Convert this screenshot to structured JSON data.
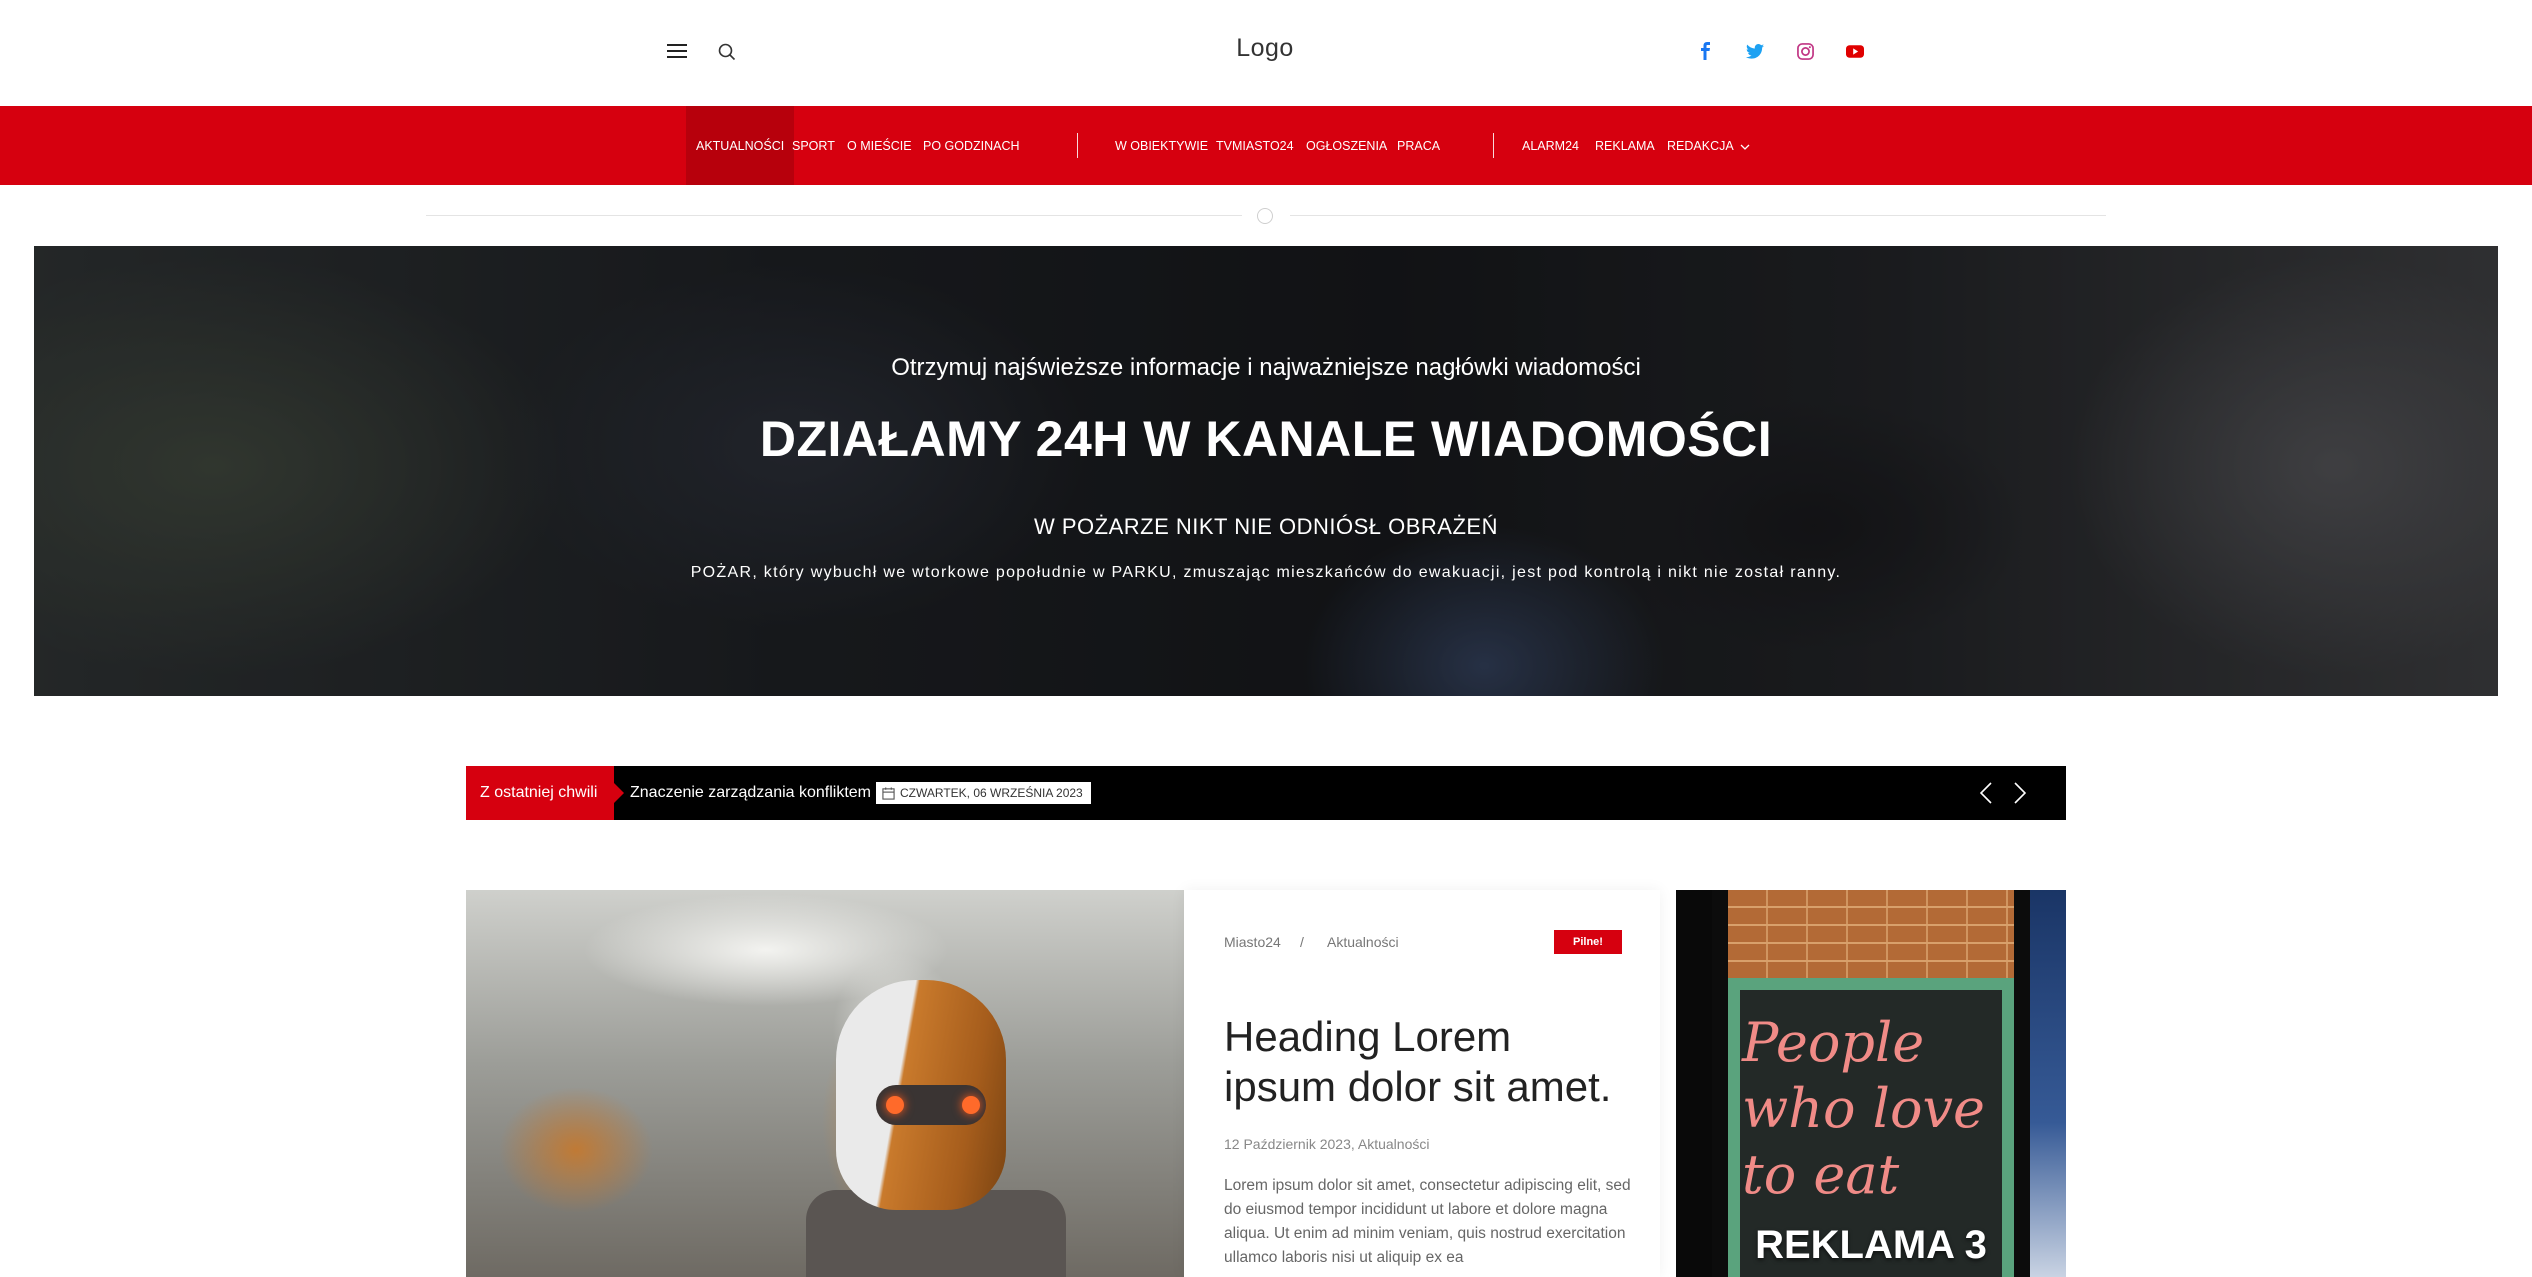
{
  "header": {
    "logo": "Logo",
    "social": [
      "facebook-icon",
      "twitter-icon",
      "instagram-icon",
      "youtube-icon"
    ]
  },
  "nav": {
    "items": [
      "AKTUALNOŚCI",
      "SPORT",
      "O MIEŚCIE",
      "PO GODZINACH",
      "W OBIEKTYWIE",
      "TVMIASTO24",
      "OGŁOSZENIA",
      "PRACA",
      "ALARM24",
      "REKLAMA",
      "REDAKCJA"
    ],
    "active": "AKTUALNOŚCI"
  },
  "hero": {
    "subtitle": "Otrzymuj najświeższe informacje i najważniejsze nagłówki wiadomości",
    "title": "DZIAŁAMY 24H W KANALE WIADOMOŚCI",
    "headline": "W POŻARZE NIKT NIE ODNIÓSŁ OBRAŻEŃ",
    "body": "POŻAR, który wybuchł we wtorkowe popołudnie w PARKU, zmuszając mieszkańców do ewakuacji, jest pod kontrolą i nikt nie został ranny."
  },
  "ticker": {
    "label": "Z ostatniej chwili",
    "headline": "Znaczenie zarządzania konfliktem",
    "date": "CZWARTEK, 06 WRZEŚNIA 2023"
  },
  "article": {
    "breadcrumb_home": "Miasto24",
    "breadcrumb_sep": "/",
    "breadcrumb_section": "Aktualności",
    "badge": "Pilne!",
    "title": "Heading Lorem ipsum dolor sit amet.",
    "meta": "12 Październik 2023, Aktualności",
    "excerpt": "Lorem ipsum dolor sit amet, consectetur adipiscing elit, sed do eiusmod tempor incididunt ut labore et dolore magna aliqua. Ut enim ad minim veniam, quis nostrud exercitation ullamco laboris nisi ut aliquip ex ea"
  },
  "ad": {
    "chalk_text": "People who love to eat",
    "label": "REKLAMA 3"
  },
  "colors": {
    "brand_red": "#d6000f",
    "ticker_bg": "#000000"
  }
}
